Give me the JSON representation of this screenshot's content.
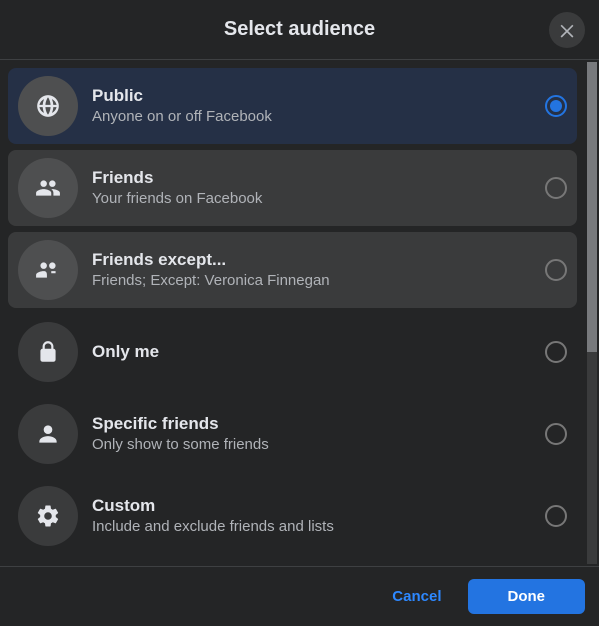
{
  "header": {
    "title": "Select audience"
  },
  "options": [
    {
      "title": "Public",
      "subtitle": "Anyone on or off Facebook",
      "selected": true,
      "state": "selected"
    },
    {
      "title": "Friends",
      "subtitle": "Your friends on Facebook",
      "selected": false,
      "state": "hover"
    },
    {
      "title": "Friends except...",
      "subtitle": "Friends; Except: Veronica Finnegan",
      "selected": false,
      "state": "hover"
    },
    {
      "title": "Only me",
      "subtitle": "",
      "selected": false,
      "state": ""
    },
    {
      "title": "Specific friends",
      "subtitle": "Only show to some friends",
      "selected": false,
      "state": ""
    },
    {
      "title": "Custom",
      "subtitle": "Include and exclude friends and lists",
      "selected": false,
      "state": ""
    }
  ],
  "footer": {
    "cancel": "Cancel",
    "done": "Done"
  }
}
